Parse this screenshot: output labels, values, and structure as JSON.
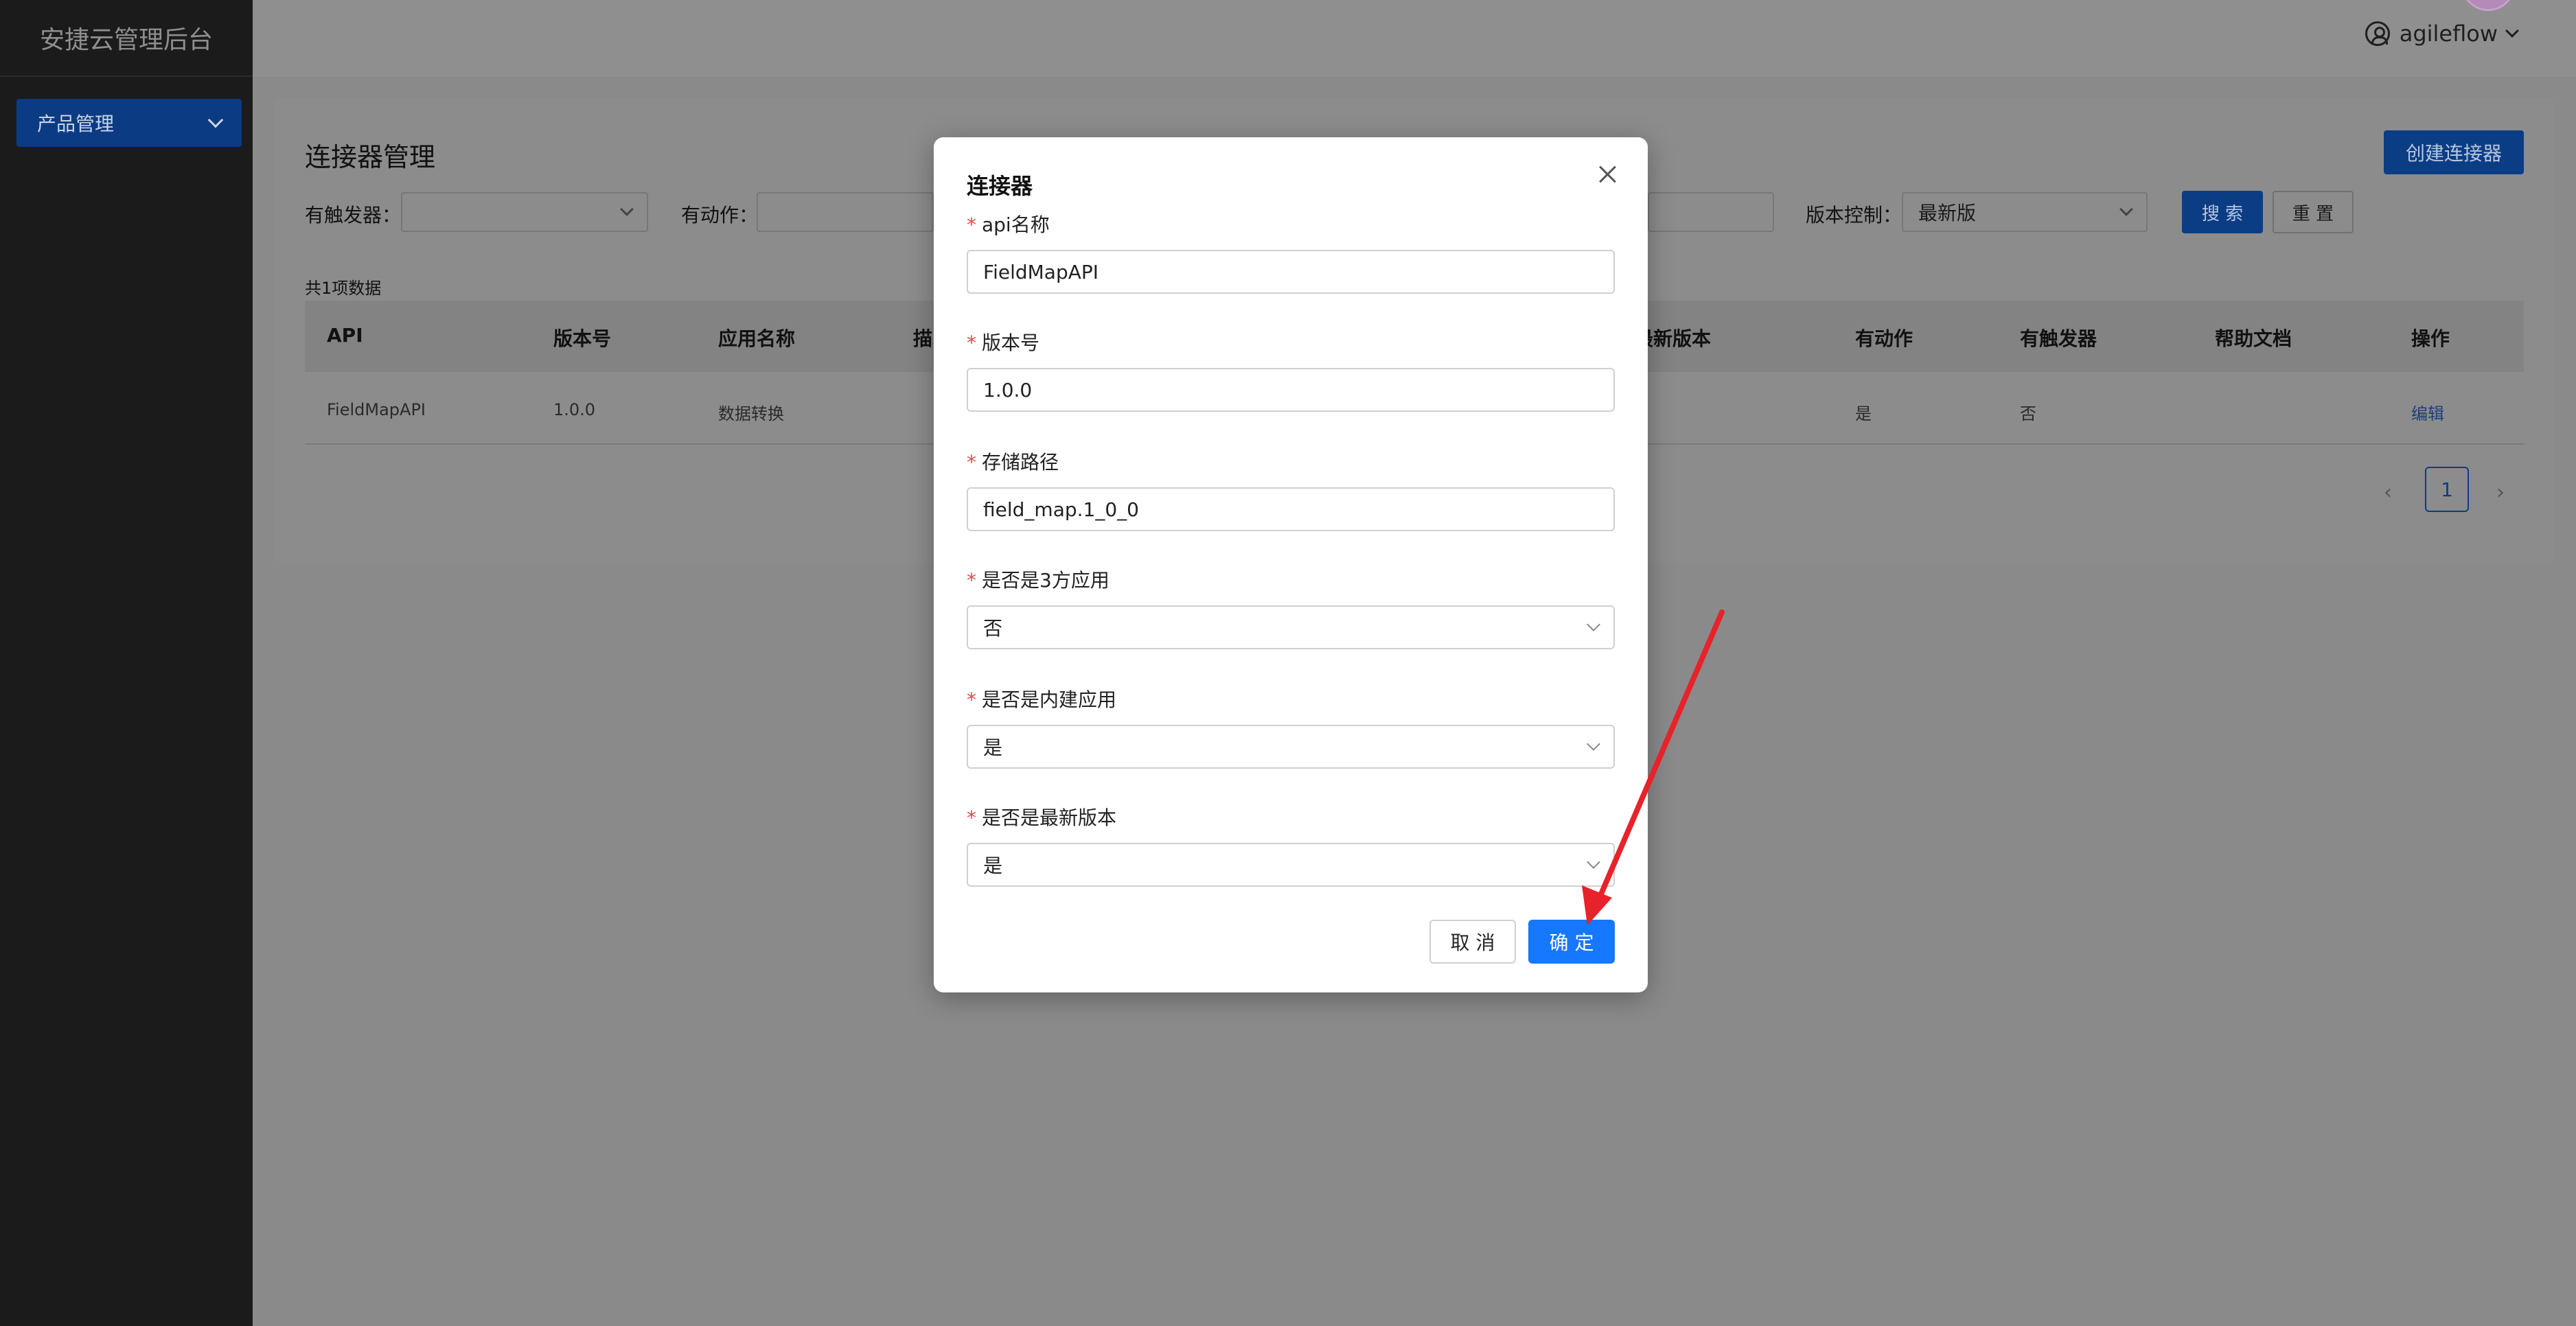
{
  "sidebar": {
    "brand": "安捷云管理后台",
    "menu": [
      {
        "label": "产品管理",
        "icon": "chevron-down-icon"
      }
    ]
  },
  "header": {
    "username": "agileflow",
    "user_icon": "user-circle-icon"
  },
  "page": {
    "title": "连接器管理",
    "create_button": "创建连接器",
    "filters": {
      "trigger_label": "有触发器：",
      "trigger_value": "",
      "action_label": "有动作：",
      "action_value": "",
      "version_label": "版本控制：",
      "version_value": "最新版"
    },
    "search_button": "搜 索",
    "reset_button": "重 置",
    "total": "共1项数据",
    "table": {
      "headers": [
        "API",
        "版本号",
        "应用名称",
        "描",
        "最新版本",
        "有动作",
        "有触发器",
        "帮助文档",
        "操作"
      ],
      "rows": [
        {
          "api": "FieldMapAPI",
          "version": "1.0.0",
          "app": "数据转换",
          "has_action": "是",
          "has_trigger": "否",
          "op": "编辑"
        }
      ]
    },
    "pagination": {
      "current": "1",
      "prev": "‹",
      "next": "›"
    }
  },
  "modal": {
    "title": "连接器",
    "fields": [
      {
        "label": "api名称",
        "value": "FieldMapAPI",
        "type": "input"
      },
      {
        "label": "版本号",
        "value": "1.0.0",
        "type": "input"
      },
      {
        "label": "存储路径",
        "value": "field_map.1_0_0",
        "type": "input"
      },
      {
        "label": "是否是3方应用",
        "value": "否",
        "type": "select"
      },
      {
        "label": "是否是内建应用",
        "value": "是",
        "type": "select"
      },
      {
        "label": "是否是最新版本",
        "value": "是",
        "type": "select"
      }
    ],
    "required_mark": "*",
    "cancel": "取 消",
    "ok": "确 定"
  },
  "colors": {
    "primary": "#1677ff",
    "annotation_arrow": "#e8222b"
  }
}
